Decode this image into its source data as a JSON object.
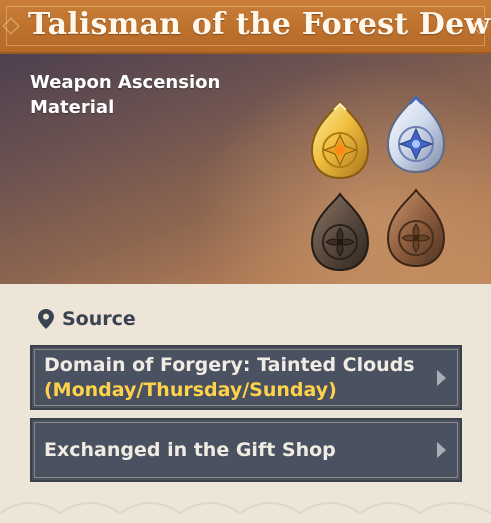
{
  "item": {
    "name": "Talisman of the Forest Dew",
    "type_line1": "Weapon Ascension",
    "type_line2": "Material",
    "icon": "talisman-set-icon"
  },
  "colors": {
    "title_bar": "#bd712d",
    "entry_bg": "#4a5160",
    "entry_text": "#f1ece3",
    "days_highlight": "#ffd24a",
    "source_text": "#3b4251",
    "panel_bg": "#ece5d8"
  },
  "source": {
    "label": "Source",
    "icon": "location-pin-icon",
    "entries": [
      {
        "text": "Domain of Forgery: Tainted Clouds",
        "detail": "(Monday/Thursday/Sunday)",
        "icon": "chevron-right-icon"
      },
      {
        "text": "Exchanged in the Gift Shop",
        "icon": "chevron-right-icon"
      }
    ]
  }
}
